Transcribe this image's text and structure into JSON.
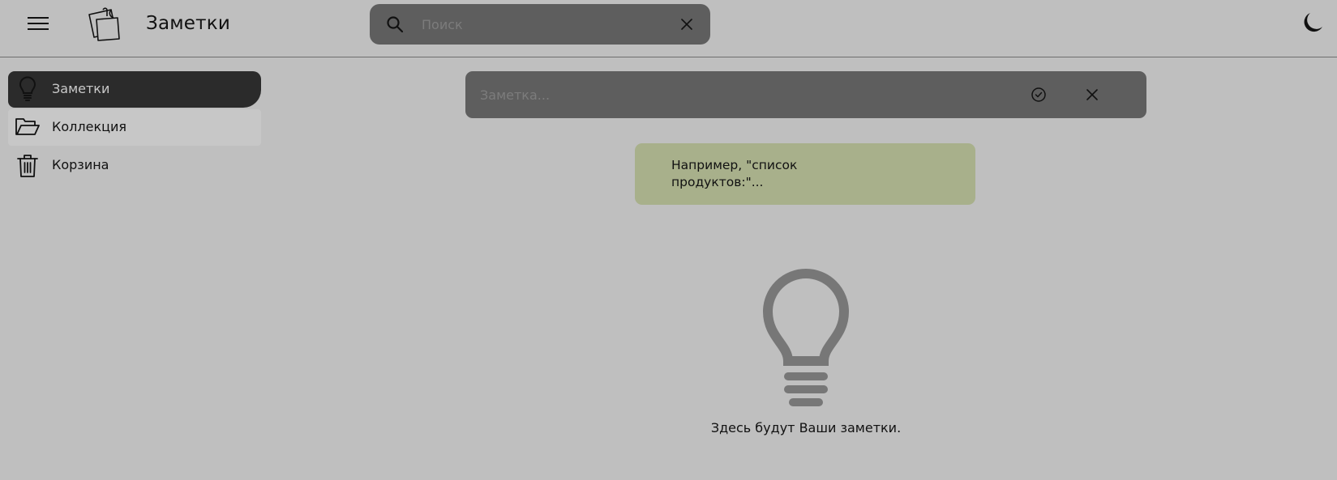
{
  "header": {
    "app_title": "Заметки",
    "menu_icon": "hamburger-icon",
    "logo_icon": "sticky-notes-icon",
    "search": {
      "placeholder": "Поиск",
      "value": "",
      "search_icon": "search-icon",
      "clear_icon": "close-icon"
    },
    "theme_icon": "moon-icon"
  },
  "sidebar": {
    "items": [
      {
        "label": "Заметки",
        "icon": "lightbulb-icon",
        "active": true
      },
      {
        "label": "Коллекция",
        "icon": "folder-open-icon",
        "active": false
      },
      {
        "label": "Корзина",
        "icon": "trash-icon",
        "active": false
      }
    ]
  },
  "editor": {
    "placeholder": "Заметка...",
    "value": "",
    "confirm_icon": "check-circle-icon",
    "close_icon": "close-icon"
  },
  "hint": {
    "text": "Например, \"список продуктов:\"..."
  },
  "empty_state": {
    "icon": "lightbulb-icon",
    "message": "Здесь будут Ваши заметки."
  },
  "colors": {
    "background": "#bfbfbf",
    "input_bg": "#5e5e5e",
    "active_nav": "#2b2b2b",
    "hint_bg": "#a8b08b",
    "empty_icon": "#777777"
  }
}
